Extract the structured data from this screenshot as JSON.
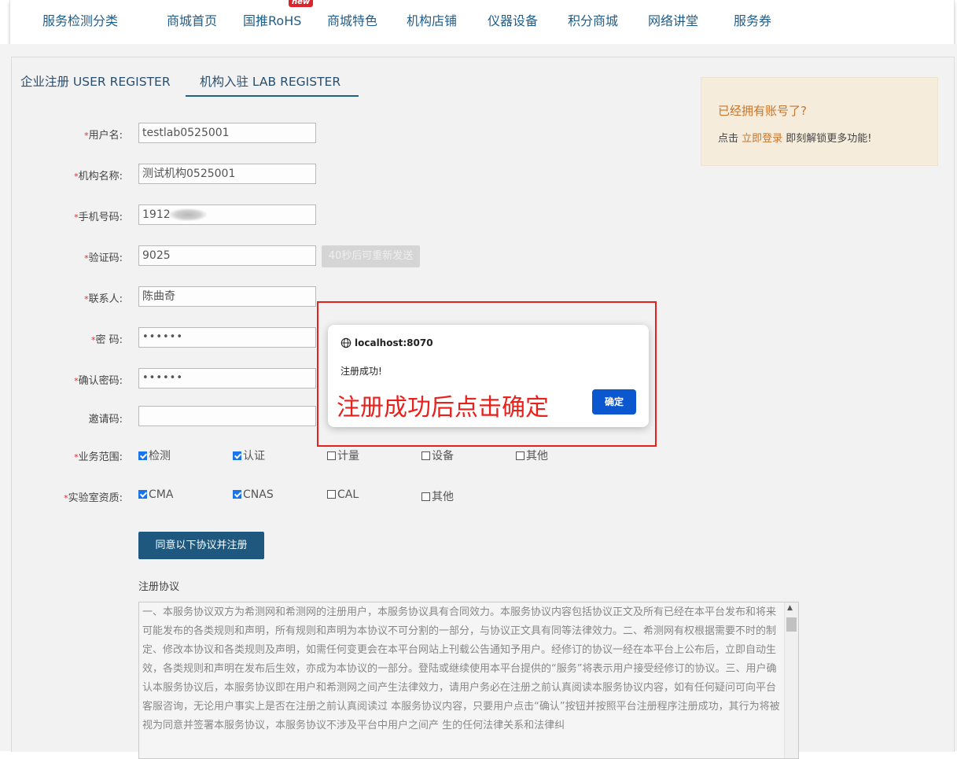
{
  "nav": {
    "items": [
      {
        "label": "服务检测分类"
      },
      {
        "label": "商城首页"
      },
      {
        "label": "国推RoHS",
        "badge": "new"
      },
      {
        "label": "商城特色"
      },
      {
        "label": "机构店铺"
      },
      {
        "label": "仪器设备"
      },
      {
        "label": "积分商城"
      },
      {
        "label": "网络讲堂"
      },
      {
        "label": "服务券"
      }
    ]
  },
  "tabs": {
    "enterprise": "企业注册  USER REGISTER",
    "lab": "机构入驻  LAB REGISTER",
    "active": "lab"
  },
  "tip": {
    "title": "已经拥有账号了?",
    "prefix": "点击 ",
    "link": "立即登录",
    "suffix": " 即刻解锁更多功能!"
  },
  "form": {
    "username": {
      "label": "用户名:",
      "required": "*",
      "value": "testlab0525001"
    },
    "org_name": {
      "label": "机构名称:",
      "required": "*",
      "value": "测试机构0525001"
    },
    "phone": {
      "label": "手机号码:",
      "required": "*",
      "value": "1912"
    },
    "code": {
      "label": "验证码:",
      "required": "*",
      "value": "9025",
      "resend": "40秒后可重新发送"
    },
    "contact": {
      "label": "联系人:",
      "required": "*",
      "value": "陈曲奇"
    },
    "password": {
      "label": "密 码:",
      "required": "*",
      "value": "••••••"
    },
    "confirm": {
      "label": "确认密码:",
      "required": "*",
      "value": "••••••"
    },
    "invite": {
      "label": "邀请码:",
      "value": ""
    },
    "scope": {
      "label": "业务范围:",
      "required": "*",
      "options": [
        {
          "label": "检测",
          "checked": true
        },
        {
          "label": "认证",
          "checked": true
        },
        {
          "label": "计量",
          "checked": false
        },
        {
          "label": "设备",
          "checked": false
        },
        {
          "label": "其他",
          "checked": false
        }
      ]
    },
    "qualification": {
      "label": "实验室资质:",
      "required": "*",
      "options": [
        {
          "label": "CMA",
          "checked": true
        },
        {
          "label": "CNAS",
          "checked": true
        },
        {
          "label": "CAL",
          "checked": false
        },
        {
          "label": "其他",
          "checked": false
        }
      ]
    },
    "submit": "同意以下协议并注册"
  },
  "agreement": {
    "title": "注册协议",
    "text": "一、本服务协议双方为希测网和希测网的注册用户，本服务协议具有合同效力。本服务协议内容包括协议正文及所有已经在本平台发布和将来可能发布的各类规则和声明，所有规则和声明为本协议不可分割的一部分，与协议正文具有同等法律效力。二、希测网有权根据需要不时的制定、修改本协议和各类规则及声明，如需任何变更会在本平台网站上刊载公告通知予用户。经修订的协议一经在本平台上公布后，立即自动生效，各类规则和声明在发布后生效，亦成为本协议的一部分。登陆或继续使用本平台提供的“服务”将表示用户接受经修订的协议。三、用户确认本服务协议后，本服务协议即在用户和希测网之间产生法律效力，请用户务必在注册之前认真阅读本服务协议内容，如有任何疑问可向平台客服咨询，无论用户事实上是否在注册之前认真阅读过 本服务协议内容，只要用户点击“确认”按钮并按照平台注册程序注册成功，其行为将被视为同意并签署本服务协议，本服务协议不涉及平台中用户之间产 生的任何法律关系和法律纠"
  },
  "dialog": {
    "origin": "localhost:8070",
    "message": "注册成功!",
    "ok": "确定",
    "annotation": "注册成功后点击确定"
  }
}
